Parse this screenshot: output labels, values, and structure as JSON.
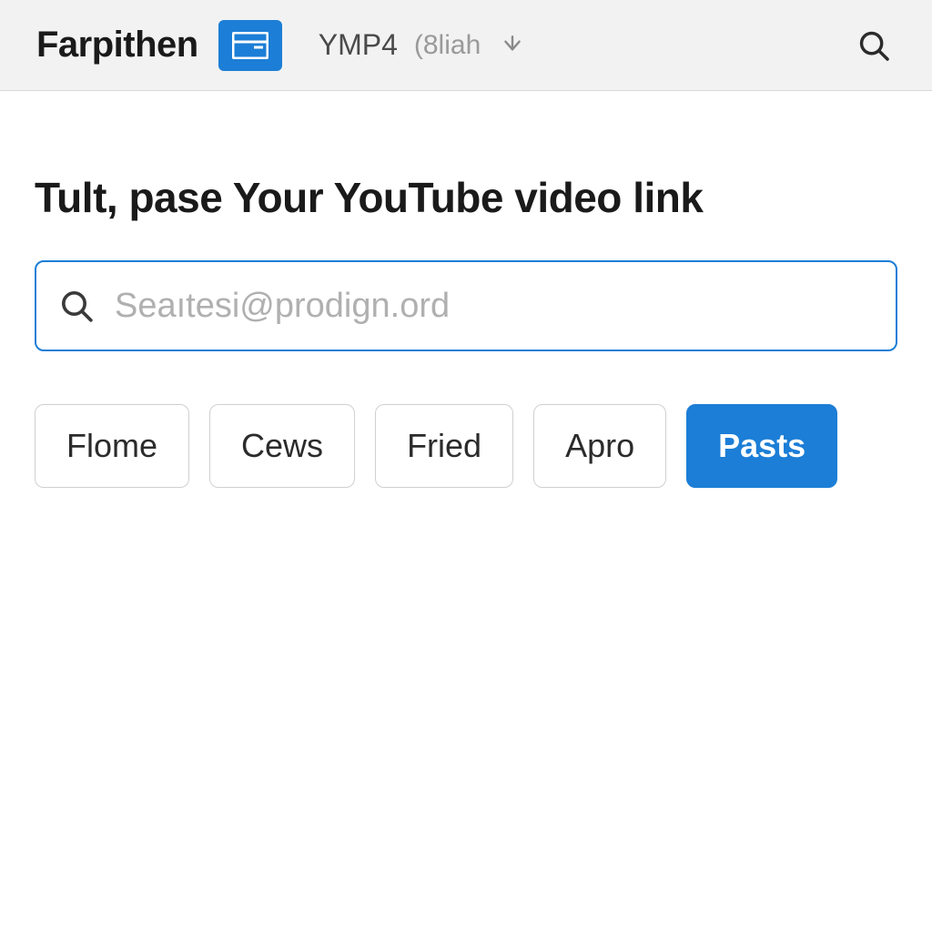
{
  "header": {
    "logo": "Farpithen",
    "nav_primary": "YMP4",
    "nav_secondary": "(8liah",
    "colors": {
      "accent": "#1c7ed6"
    }
  },
  "main": {
    "heading": "Tult, pase Your YouTube video link",
    "search": {
      "placeholder": "Seaıtesi@prodign.ord",
      "value": ""
    },
    "tabs": [
      {
        "label": "Flome",
        "active": false
      },
      {
        "label": "Cews",
        "active": false
      },
      {
        "label": "Fried",
        "active": false
      },
      {
        "label": "Apro",
        "active": false
      },
      {
        "label": "Pasts",
        "active": true
      }
    ]
  }
}
